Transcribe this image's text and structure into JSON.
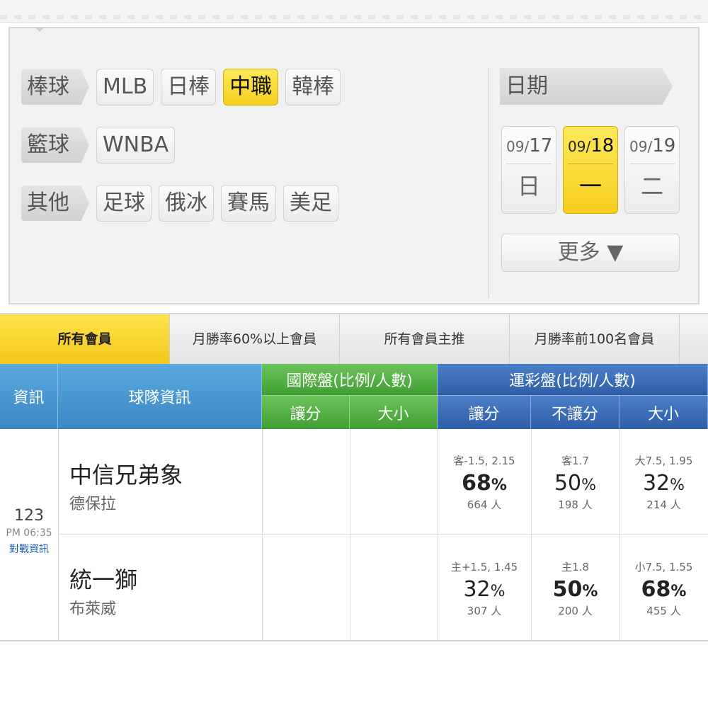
{
  "filters": {
    "rows": [
      {
        "label": "棒球",
        "items": [
          {
            "label": "MLB",
            "active": false
          },
          {
            "label": "日棒",
            "active": false
          },
          {
            "label": "中職",
            "active": true
          },
          {
            "label": "韓棒",
            "active": false
          }
        ]
      },
      {
        "label": "籃球",
        "items": [
          {
            "label": "WNBA",
            "active": false
          }
        ]
      },
      {
        "label": "其他",
        "items": [
          {
            "label": "足球",
            "active": false
          },
          {
            "label": "俄冰",
            "active": false
          },
          {
            "label": "賽馬",
            "active": false
          },
          {
            "label": "美足",
            "active": false
          }
        ]
      }
    ],
    "date_label": "日期",
    "dates": [
      {
        "month": "09/",
        "day": "17",
        "weekday": "日",
        "active": false
      },
      {
        "month": "09/",
        "day": "18",
        "weekday": "一",
        "active": true
      },
      {
        "month": "09/",
        "day": "19",
        "weekday": "二",
        "active": false
      }
    ],
    "more_label": "更多 ▼"
  },
  "tabs": [
    {
      "label": "所有會員",
      "active": true
    },
    {
      "label": "月勝率60%以上會員",
      "active": false
    },
    {
      "label": "所有會員主推",
      "active": false
    },
    {
      "label": "月勝率前100名會員",
      "active": false
    }
  ],
  "table": {
    "headers": {
      "info": "資訊",
      "team": "球隊資訊",
      "intl": "國際盤(比例/人數)",
      "lottery": "運彩盤(比例/人數)",
      "intl_spread": "讓分",
      "intl_total": "大小",
      "lot_spread": "讓分",
      "lot_ml": "不讓分",
      "lot_total": "大小"
    },
    "game": {
      "number": "123",
      "time": "PM 06:35",
      "link": "對戰資訊",
      "teams": [
        {
          "name": "中信兄弟象",
          "pitcher": "德保拉",
          "lot_spread": {
            "line": "客-1.5, 2.15",
            "pct": "68",
            "count": "664 人",
            "bold": true
          },
          "lot_ml": {
            "line": "客1.7",
            "pct": "50",
            "count": "198 人",
            "bold": false
          },
          "lot_total": {
            "line": "大7.5, 1.95",
            "pct": "32",
            "count": "214 人",
            "bold": false
          }
        },
        {
          "name": "統一獅",
          "pitcher": "布萊威",
          "lot_spread": {
            "line": "主+1.5, 1.45",
            "pct": "32",
            "count": "307 人",
            "bold": false
          },
          "lot_ml": {
            "line": "主1.8",
            "pct": "50",
            "count": "200 人",
            "bold": true
          },
          "lot_total": {
            "line": "小7.5, 1.55",
            "pct": "68",
            "count": "455 人",
            "bold": true
          }
        }
      ]
    },
    "percent_sign": "%"
  }
}
